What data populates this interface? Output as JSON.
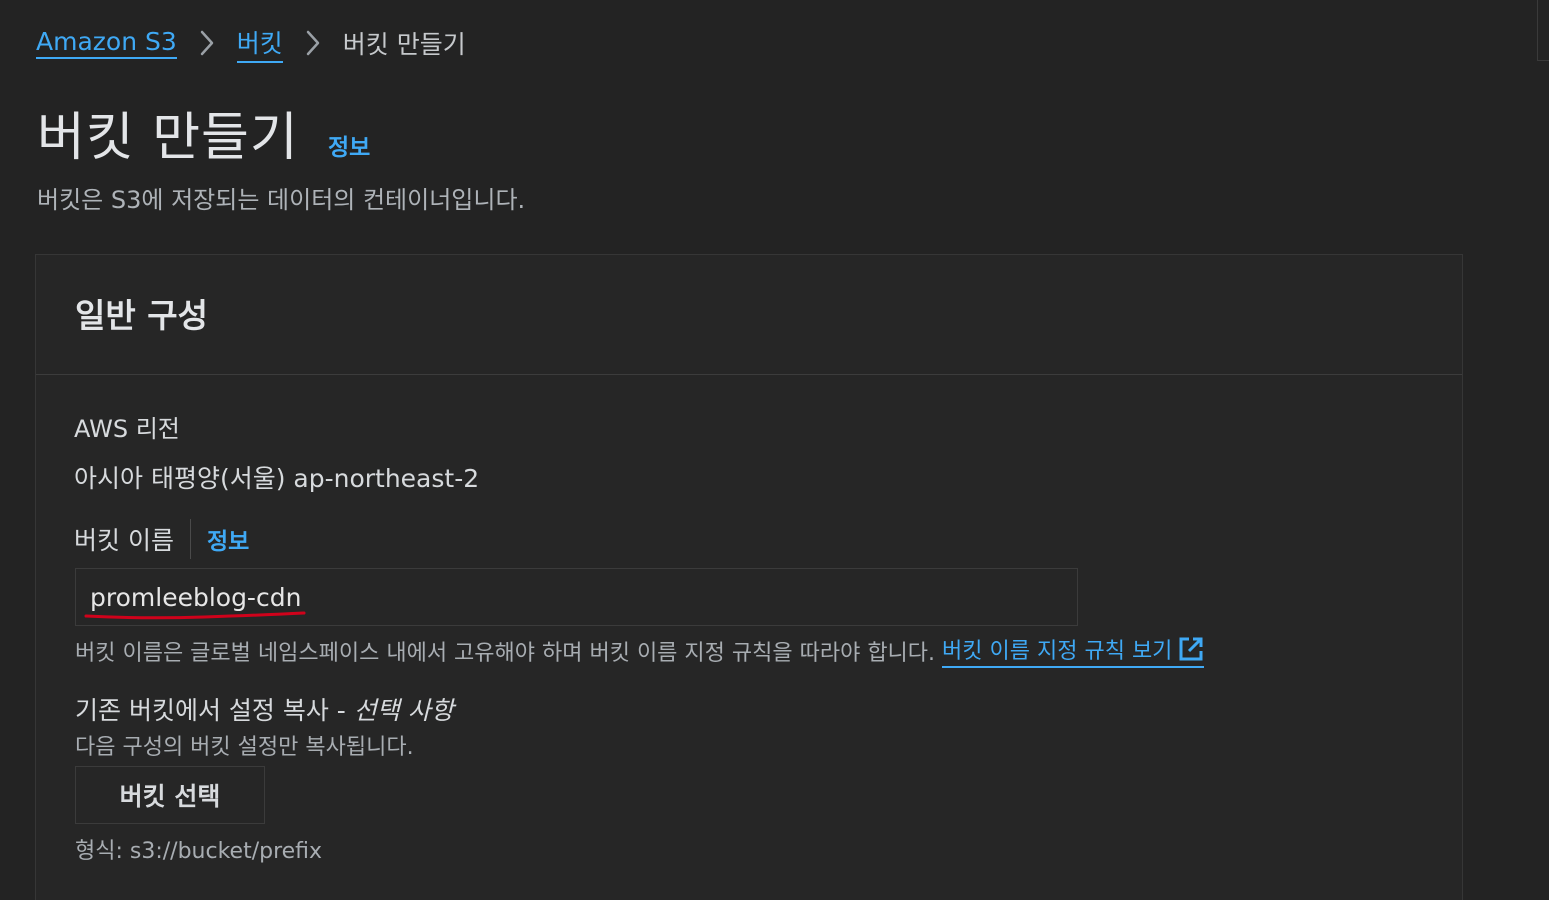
{
  "breadcrumb": {
    "items": [
      {
        "label": "Amazon S3"
      },
      {
        "label": "버킷"
      },
      {
        "label": "버킷 만들기"
      }
    ]
  },
  "header": {
    "title": "버킷 만들기",
    "info_link": "정보",
    "description": "버킷은 S3에 저장되는 데이터의 컨테이너입니다."
  },
  "general_config": {
    "title": "일반 구성",
    "region": {
      "label": "AWS 리전",
      "value": "아시아 태평양(서울) ap-northeast-2"
    },
    "bucket_name": {
      "label": "버킷 이름",
      "info_link": "정보",
      "value": "promleeblog-cdn",
      "help_text": "버킷 이름은 글로벌 네임스페이스 내에서 고유해야 하며 버킷 이름 지정 규칙을 따라야 합니다.",
      "rules_link": "버킷 이름 지정 규칙 보기"
    },
    "copy_settings": {
      "label": "기존 버킷에서 설정 복사 - ",
      "optional": "선택 사항",
      "description": "다음 구성의 버킷 설정만 복사됩니다.",
      "button_label": "버킷 선택",
      "format_hint": "형식: s3://bucket/prefix"
    }
  },
  "colors": {
    "background": "#232323",
    "link": "#3fa9f5",
    "annotation": "#d0021b"
  },
  "icons": {
    "breadcrumb_separator": "chevron-right-icon",
    "external_link": "external-link-icon"
  }
}
